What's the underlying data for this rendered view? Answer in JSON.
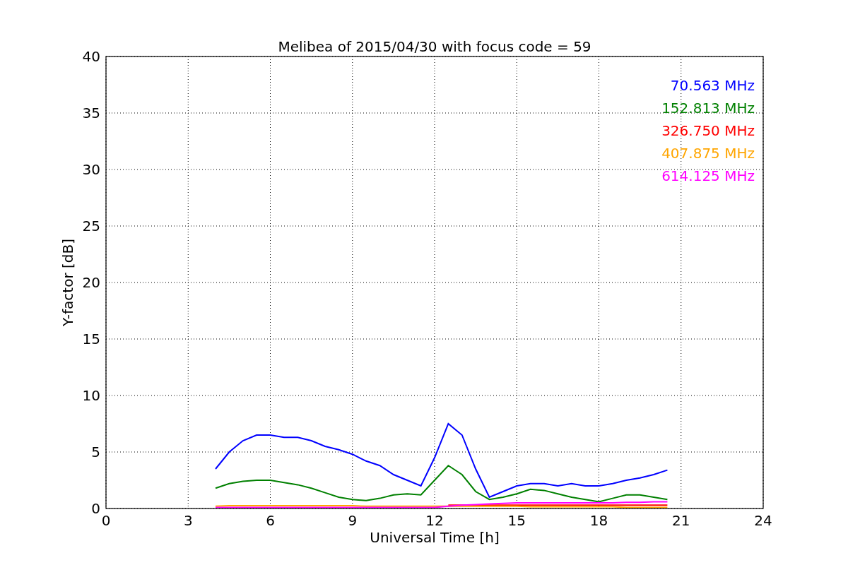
{
  "chart_data": {
    "type": "line",
    "title": "Melibea of 2015/04/30 with focus code = 59",
    "xlabel": "Universal Time [h]",
    "ylabel": "Y-factor [dB]",
    "x": [
      4,
      4.5,
      5,
      5.5,
      6,
      6.5,
      7,
      7.5,
      8,
      8.5,
      9,
      9.5,
      10,
      10.5,
      11,
      11.5,
      12,
      12.5,
      13,
      13.5,
      14,
      14.5,
      15,
      15.5,
      16,
      16.5,
      17,
      17.5,
      18,
      18.5,
      19,
      19.5,
      20,
      20.5
    ],
    "series": [
      {
        "name": "70.563 MHz",
        "color": "#0000ff",
        "values": [
          3.5,
          5,
          6,
          6.5,
          6.5,
          6.3,
          6.3,
          6,
          5.5,
          5.2,
          4.8,
          4.2,
          3.8,
          3,
          2.5,
          2,
          4.5,
          7.5,
          6.5,
          3.5,
          1,
          1.5,
          2,
          2.2,
          2.2,
          2,
          2.2,
          2,
          2,
          2.2,
          2.5,
          2.7,
          3,
          3.4
        ]
      },
      {
        "name": "152.813 MHz",
        "color": "#008000",
        "values": [
          1.8,
          2.2,
          2.4,
          2.5,
          2.5,
          2.3,
          2.1,
          1.8,
          1.4,
          1,
          0.8,
          0.7,
          0.9,
          1.2,
          1.3,
          1.2,
          2.5,
          3.8,
          3,
          1.5,
          0.8,
          1,
          1.3,
          1.7,
          1.6,
          1.3,
          1,
          0.8,
          0.6,
          0.9,
          1.2,
          1.2,
          1,
          0.8
        ]
      },
      {
        "name": "326.750 MHz",
        "color": "#ff0000",
        "values": [
          null,
          null,
          null,
          null,
          null,
          null,
          null,
          null,
          null,
          null,
          null,
          null,
          null,
          null,
          null,
          null,
          null,
          0.3,
          0.3,
          0.3,
          0.3,
          0.3,
          0.3,
          0.3,
          0.3,
          0.3,
          0.3,
          0.3,
          0.3,
          0.3,
          0.3,
          0.3,
          0.3,
          0.3
        ]
      },
      {
        "name": "407.875 MHz",
        "color": "#ffa500",
        "values": [
          0.2,
          0.25,
          0.25,
          0.25,
          0.25,
          0.25,
          0.25,
          0.25,
          0.25,
          0.25,
          0.25,
          0.2,
          0.2,
          0.2,
          0.2,
          0.2,
          0.2,
          0.2,
          0.2,
          0.2,
          0.2,
          0.2,
          0.2,
          0.15,
          0.15,
          0.15,
          0.15,
          0.15,
          0.15,
          0.15,
          0.1,
          0.1,
          0.1,
          0.1
        ]
      },
      {
        "name": "614.125 MHz",
        "color": "#ff00ff",
        "values": [
          0.1,
          0.1,
          0.1,
          0.1,
          0.1,
          0.1,
          0.1,
          0.1,
          0.1,
          0.1,
          0.1,
          0.1,
          0.1,
          0.1,
          0.1,
          0.1,
          0.1,
          0.2,
          0.3,
          0.35,
          0.4,
          0.45,
          0.5,
          0.5,
          0.5,
          0.5,
          0.5,
          0.5,
          0.5,
          0.5,
          0.55,
          0.55,
          0.6,
          0.6
        ]
      }
    ],
    "grid": true,
    "xlim": [
      0,
      24
    ],
    "ylim": [
      0,
      40
    ],
    "xticks": [
      0,
      3,
      6,
      9,
      12,
      15,
      18,
      21,
      24
    ],
    "yticks": [
      0,
      5,
      10,
      15,
      20,
      25,
      30,
      35,
      40
    ]
  }
}
